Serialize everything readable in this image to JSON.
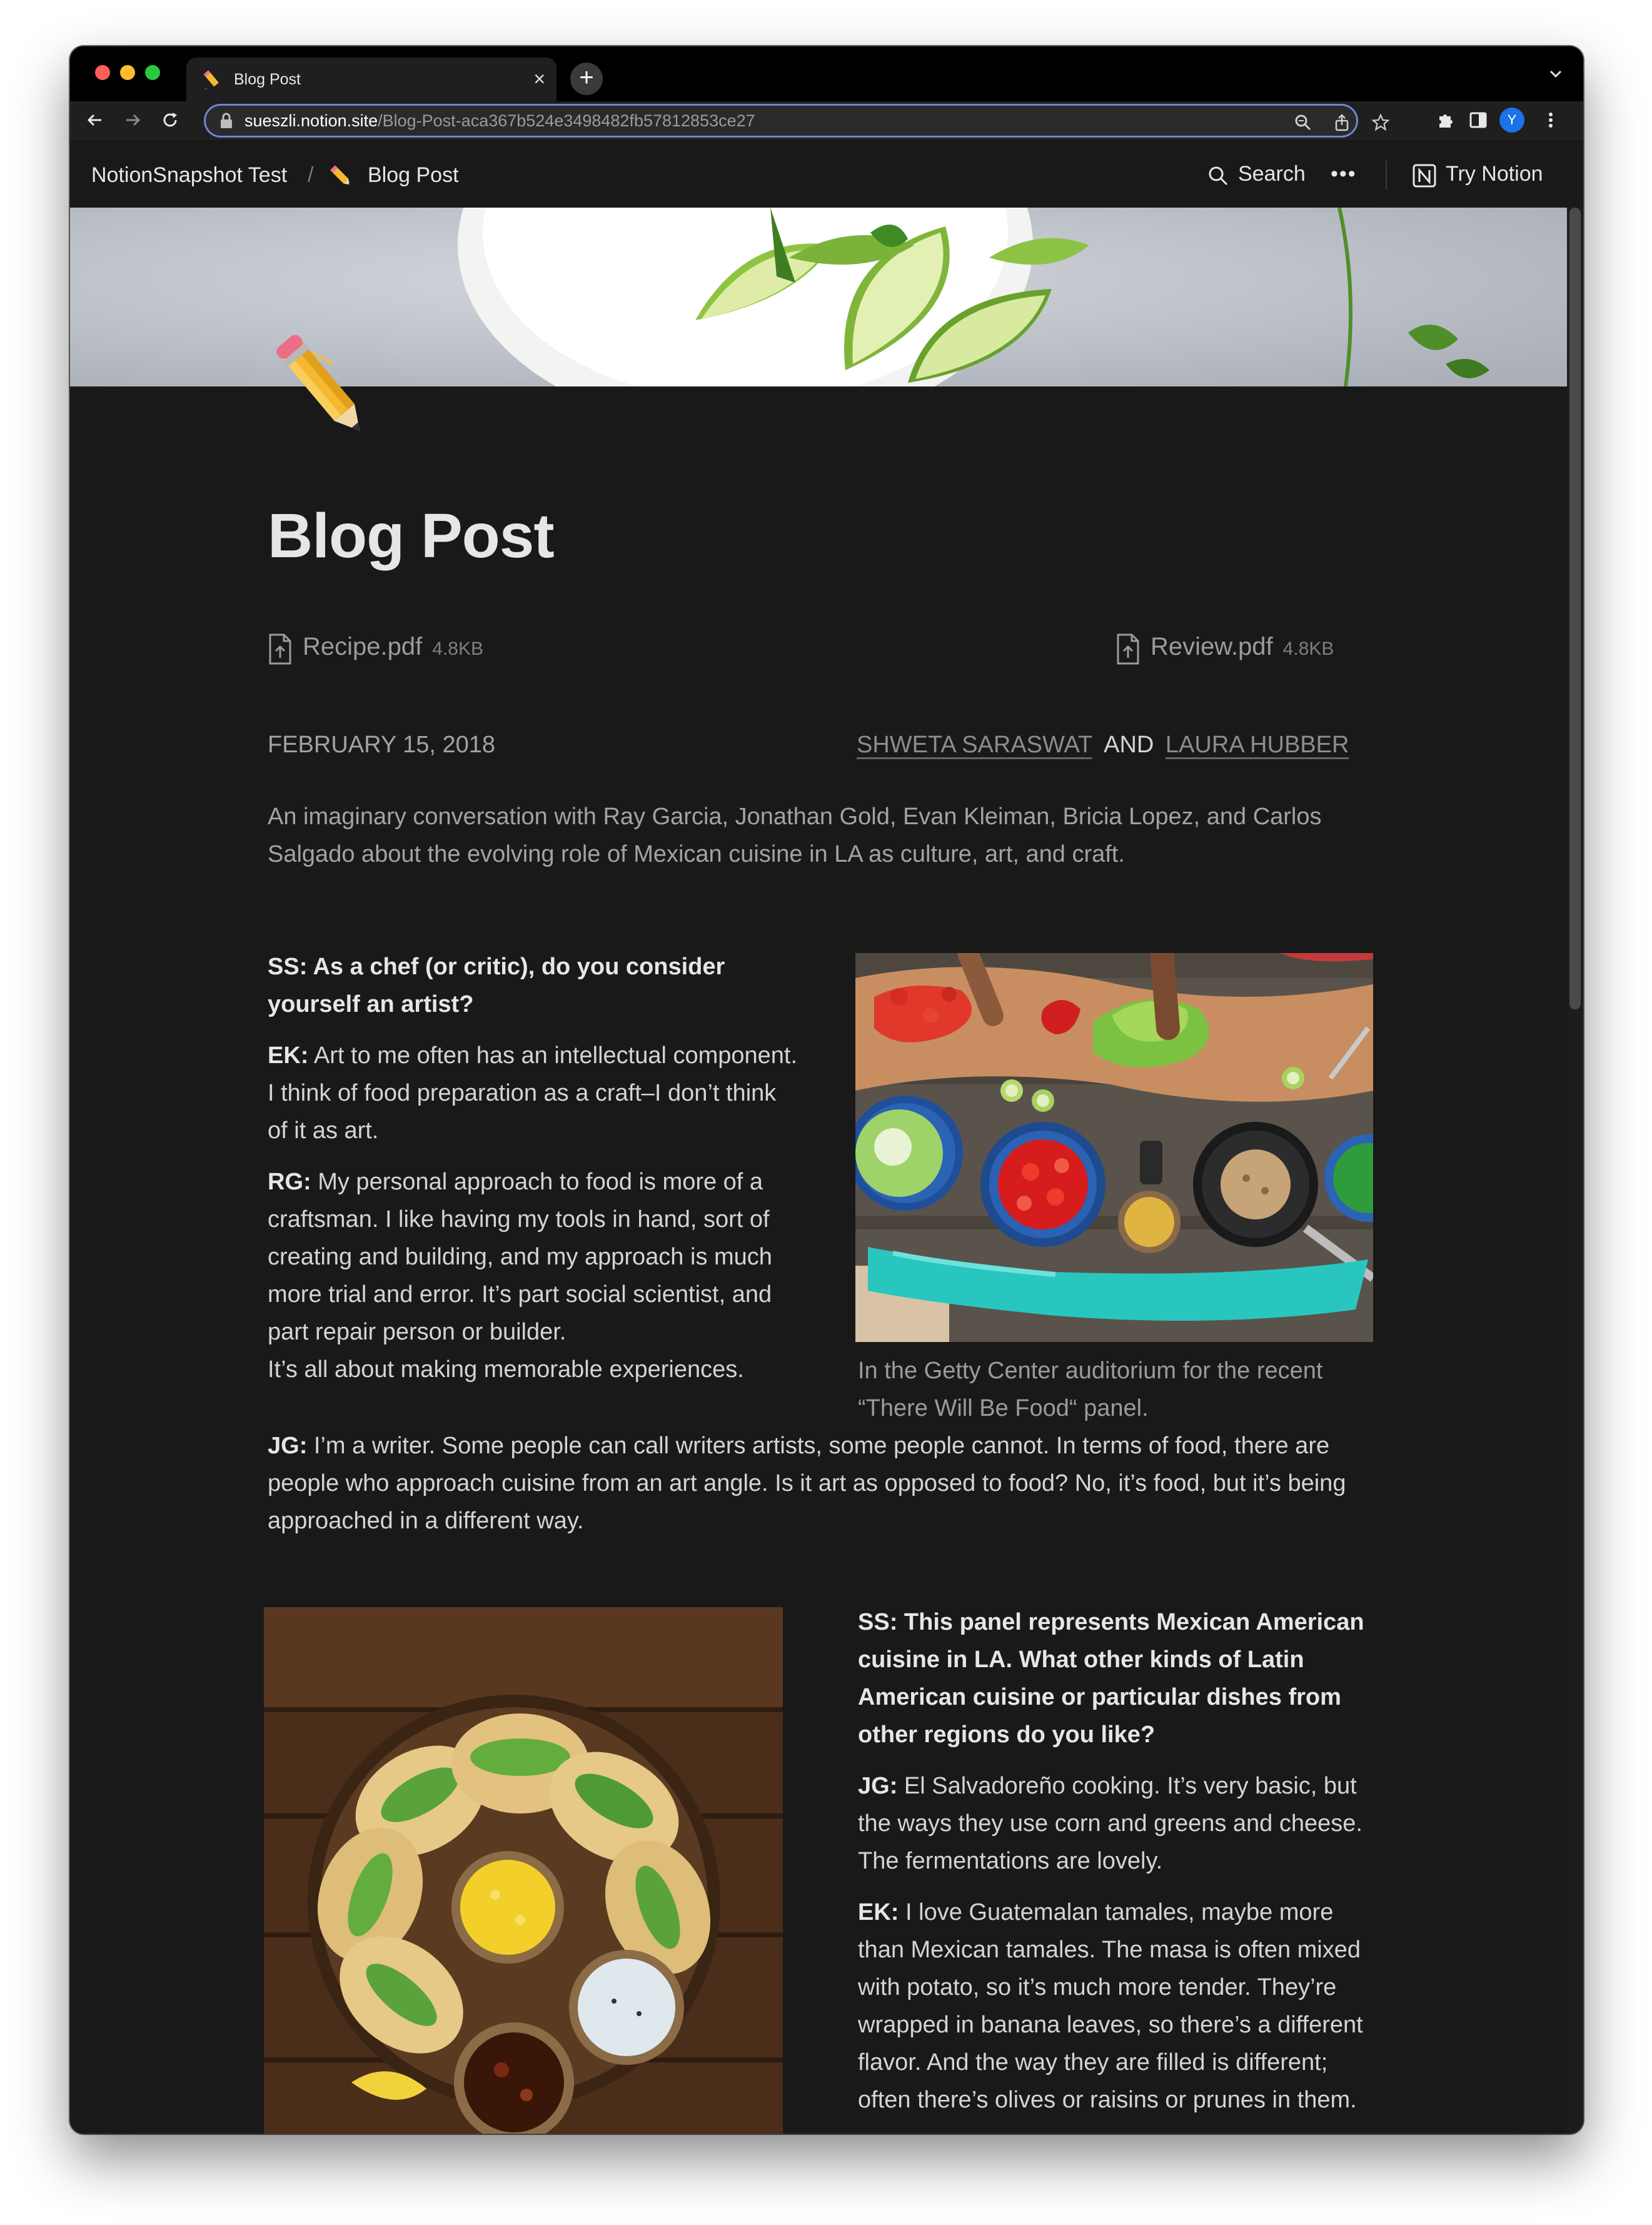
{
  "browser": {
    "tab_title": "Blog Post",
    "new_tab_label": "+",
    "close_label": "×",
    "url_host": "sueszli.notion.site",
    "url_path": "/Blog-Post-aca367b524e3498482fb57812853ce27",
    "profile_initial": "Y"
  },
  "topbar": {
    "workspace": "NotionSnapshot Test",
    "separator": "/",
    "page_name": "Blog Post",
    "search_label": "Search",
    "more_label": "•••",
    "try_label": "Try Notion"
  },
  "page": {
    "title": "Blog Post",
    "files": [
      {
        "name": "Recipe.pdf",
        "size": "4.8KB"
      },
      {
        "name": "Review.pdf",
        "size": "4.8KB"
      }
    ],
    "date": "FEBRUARY 15, 2018",
    "author1": "SHWETA SARASWAT",
    "author_join": "AND",
    "author2": "LAURA HUBBER",
    "intro": "An imaginary conversation with Ray Garcia, Jonathan Gold, Evan Kleiman, Bricia Lopez, and Carlos Salgado about the evolving role of Mexican cuisine in LA as culture, art, and craft.",
    "q1": "SS: As a chef (or critic), do you consider yourself an artist?",
    "ek1_speaker": "EK:",
    "ek1_text": "Art to me often has an intellectual component. I think of food preparation as a craft–I don’t think of it as art.",
    "rg_speaker": "RG:",
    "rg_text": "My personal approach to food is more of a craftsman. I like having my tools in hand, sort of creating and building, and my approach is much more trial and error. It’s part social scientist, and part repair person or builder.",
    "rg_text2": "It’s all about making memorable experiences.",
    "caption": "In the Getty Center auditorium for the recent “There Will Be Food“ panel.",
    "jg1_speaker": "JG:",
    "jg1_text": "I’m a writer. Some people can call writers artists, some people cannot. In terms of food, there are people who approach cuisine from an art angle. Is it art as opposed to food? No, it’s food, but it’s being approached in a different way.",
    "q2": "SS: This panel represents Mexican American cuisine in LA. What other kinds of Latin American cuisine or particular dishes from other regions do you like?",
    "jg2_speaker": "JG:",
    "jg2_text": "El Salvadoreño cooking. It’s very basic, but the ways they use corn and greens and cheese. The fermentations are lovely.",
    "ek2_speaker": "EK:",
    "ek2_text": "I love Guatemalan tamales, maybe more than Mexican tamales. The masa is often mixed with potato, so it’s much more tender. They’re wrapped in banana leaves, so there’s a different flavor. And the way they are filled is different; often there’s olives or raisins or prunes in them."
  },
  "icons": {
    "page_icon": "pencil-icon",
    "file_icon": "file-upload-icon",
    "search_icon": "magnifier-icon"
  },
  "colors": {
    "page_bg": "#191919",
    "text": "#d4d4d4",
    "muted": "#9b9b9b",
    "omnibox_focus": "#6f86d6"
  }
}
